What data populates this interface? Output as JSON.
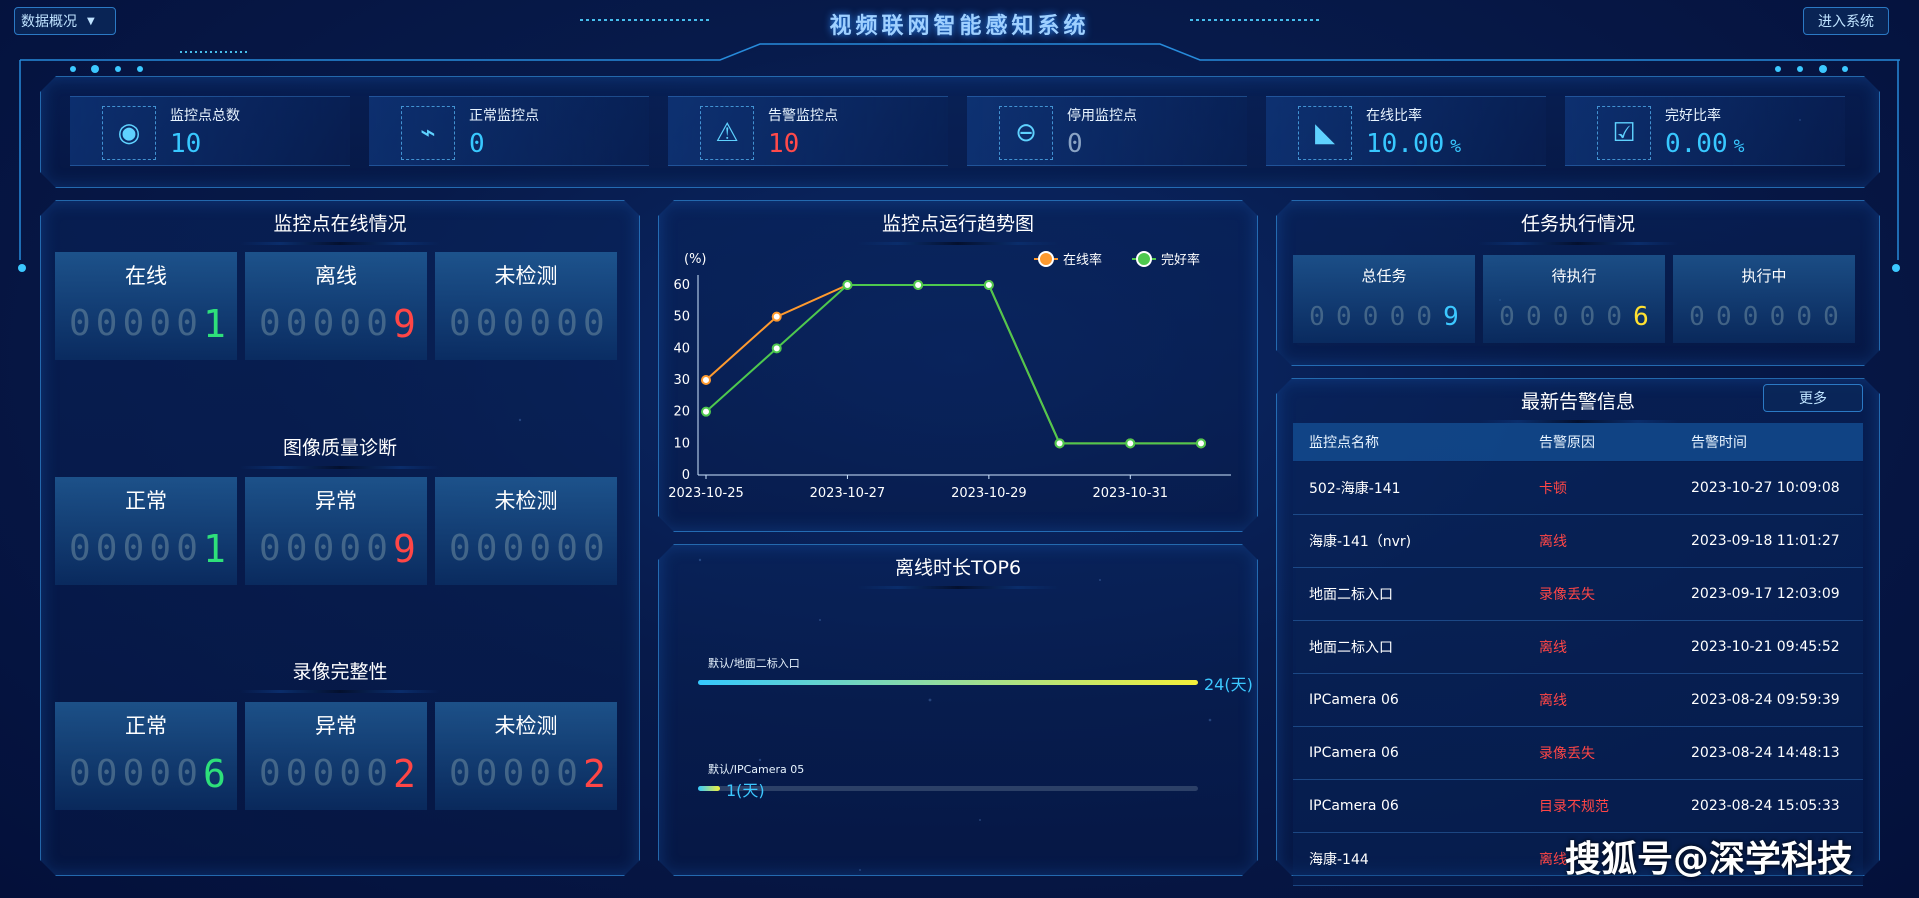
{
  "header": {
    "dropdown_label": "数据概况",
    "title": "视频联网智能感知系统",
    "enter_label": "进入系统"
  },
  "kpis": [
    {
      "label": "监控点总数",
      "value": "10",
      "icon": "camera-icon",
      "color": "#38c8ff"
    },
    {
      "label": "正常监控点",
      "value": "0",
      "icon": "cctv-icon",
      "color": "#38c8ff"
    },
    {
      "label": "告警监控点",
      "value": "10",
      "icon": "alarm-light-icon",
      "color": "#ff4a4a"
    },
    {
      "label": "停用监控点",
      "value": "0",
      "icon": "minus-circle-icon",
      "color": "#8aa3c4"
    },
    {
      "label": "在线比率",
      "value": "10.00",
      "unit": "%",
      "icon": "trend-chart-icon",
      "color": "#38c8ff"
    },
    {
      "label": "完好比率",
      "value": "0.00",
      "unit": "%",
      "icon": "clipboard-check-icon",
      "color": "#38c8ff"
    }
  ],
  "online": {
    "title": "监控点在线情况",
    "cards": [
      {
        "label": "在线",
        "digits": "000001",
        "color": "#2ee07a"
      },
      {
        "label": "离线",
        "digits": "000009",
        "color": "#ff4646"
      },
      {
        "label": "未检测",
        "digits": "000000",
        "color": "#6f8ca3"
      }
    ]
  },
  "quality": {
    "title": "图像质量诊断",
    "cards": [
      {
        "label": "正常",
        "digits": "000001",
        "color": "#2ee07a"
      },
      {
        "label": "异常",
        "digits": "000009",
        "color": "#ff4646"
      },
      {
        "label": "未检测",
        "digits": "000000",
        "color": "#6f8ca3"
      }
    ]
  },
  "record": {
    "title": "录像完整性",
    "cards": [
      {
        "label": "正常",
        "digits": "000006",
        "color": "#2ee07a"
      },
      {
        "label": "异常",
        "digits": "000002",
        "color": "#ff4646"
      },
      {
        "label": "未检测",
        "digits": "000002",
        "color": "#ff4646"
      }
    ]
  },
  "trend": {
    "title": "监控点运行趋势图"
  },
  "top6": {
    "title": "离线时长TOP6",
    "max": 24,
    "items": [
      {
        "name": "默认/地面二标入口",
        "value": 24,
        "label": "24(天)"
      },
      {
        "name": "默认/IPCamera 05",
        "value": 1,
        "label": "1(天)"
      }
    ]
  },
  "tasks": {
    "title": "任务执行情况",
    "cards": [
      {
        "label": "总任务",
        "digits": "000009",
        "color": "#3cc8ff"
      },
      {
        "label": "待执行",
        "digits": "000006",
        "color": "#ffe030"
      },
      {
        "label": "执行中",
        "digits": "000000",
        "color": "#6f8ca3"
      }
    ]
  },
  "alerts": {
    "title": "最新告警信息",
    "more_label": "更多",
    "columns": [
      "监控点名称",
      "告警原因",
      "告警时间"
    ],
    "rows": [
      [
        "502-海康-141",
        "卡顿",
        "2023-10-27 10:09:08"
      ],
      [
        "海康-141（nvr)",
        "离线",
        "2023-09-18 11:01:27"
      ],
      [
        "地面二标入口",
        "录像丢失",
        "2023-09-17 12:03:09"
      ],
      [
        "地面二标入口",
        "离线",
        "2023-10-21 09:45:52"
      ],
      [
        "IPCamera 06",
        "离线",
        "2023-08-24 09:59:39"
      ],
      [
        "IPCamera 06",
        "录像丢失",
        "2023-08-24 14:48:13"
      ],
      [
        "IPCamera 06",
        "目录不规范",
        "2023-08-24 15:05:33"
      ],
      [
        "海康-144",
        "离线",
        ""
      ]
    ]
  },
  "watermark": "搜狐号@深学科技",
  "chart_data": {
    "type": "line",
    "title": "监控点运行趋势图",
    "ylabel": "(%)",
    "xlabel": "",
    "ylim": [
      0,
      60
    ],
    "yticks": [
      0,
      10,
      20,
      30,
      40,
      50,
      60
    ],
    "xlim": [
      "2023-10-25",
      "2023-11-01"
    ],
    "xtick_labels": [
      "2023-10-25",
      "2023-10-27",
      "2023-10-29",
      "2023-10-31"
    ],
    "x": [
      "2023-10-25",
      "2023-10-26",
      "2023-10-27",
      "2023-10-28",
      "2023-10-29",
      "2023-10-30",
      "2023-10-31",
      "2023-11-01"
    ],
    "series": [
      {
        "name": "在线率",
        "color": "#ff9a2e",
        "values": [
          30,
          50,
          60,
          60,
          60,
          10,
          10,
          10
        ]
      },
      {
        "name": "完好率",
        "color": "#4ec94e",
        "values": [
          20,
          40,
          60,
          60,
          60,
          10,
          10,
          10
        ]
      }
    ],
    "legend": "top-right",
    "grid": false
  }
}
